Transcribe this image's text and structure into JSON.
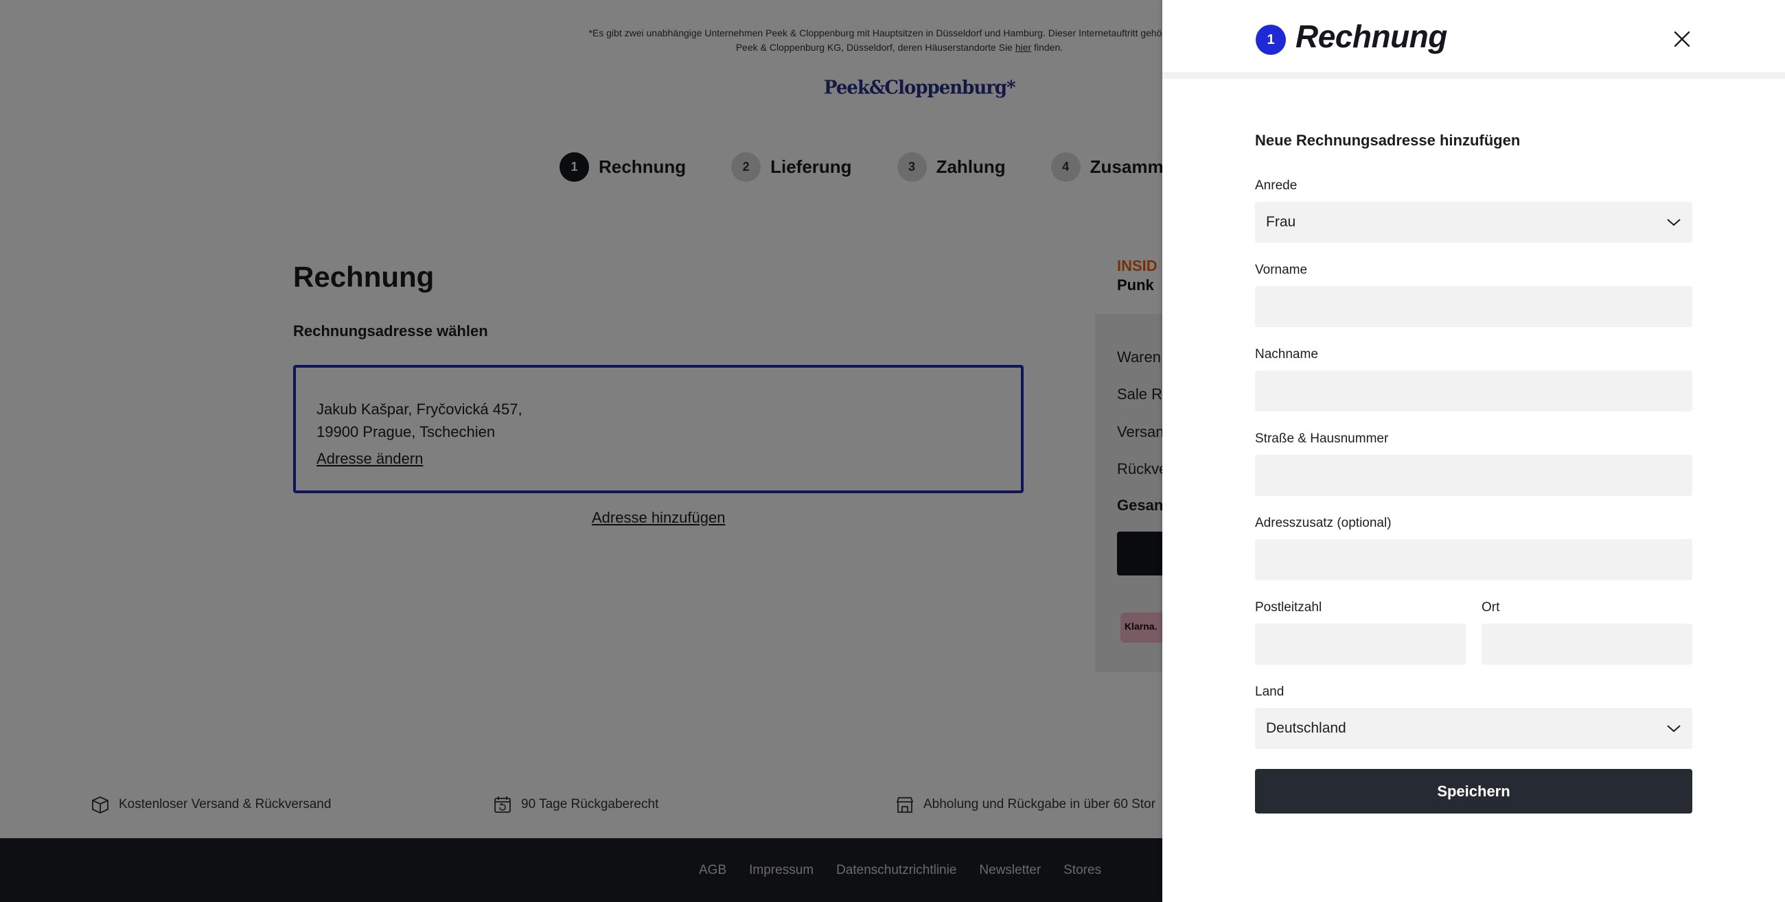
{
  "notice": {
    "line1": "*Es gibt zwei unabhängige Unternehmen Peek & Cloppenburg mit Hauptsitzen in Düsseldorf und Hamburg. Dieser Internetauftritt gehört zur Unter",
    "line2_before": "Peek & Cloppenburg KG, Düsseldorf, deren Häuserstandorte Sie ",
    "link": "hier",
    "line2_after": " finden."
  },
  "logo": "Peek&Cloppenburg*",
  "steps": [
    {
      "num": "1",
      "label": "Rechnung"
    },
    {
      "num": "2",
      "label": "Lieferung"
    },
    {
      "num": "3",
      "label": "Zahlung"
    },
    {
      "num": "4",
      "label": "Zusammenf"
    }
  ],
  "main": {
    "title": "Rechnung",
    "subtitle": "Rechnungsadresse wählen",
    "address_line1": "Jakub Kašpar, Fryčovická 457,",
    "address_line2": "19900 Prague, Tschechien",
    "change_link": "Adresse ändern",
    "add_link": "Adresse hinzufügen"
  },
  "summary": {
    "insider_1": "INSID",
    "insider_2": "Punk",
    "rows": [
      "Waren",
      "Sale R",
      "Versan",
      "Rückve"
    ],
    "total": "Gesan",
    "klarna": "Klarna."
  },
  "features": [
    {
      "icon": "package-icon",
      "text": "Kostenloser Versand & Rückversand"
    },
    {
      "icon": "calendar-return-icon",
      "text": "90 Tage Rückgaberecht"
    },
    {
      "icon": "store-icon",
      "text": "Abholung und Rückgabe in über 60 Stor"
    }
  ],
  "footer": {
    "links": [
      "AGB",
      "Impressum",
      "Datenschutzrichtlinie",
      "Newsletter",
      "Stores"
    ]
  },
  "panel": {
    "step_num": "1",
    "title": "Rechnung",
    "form_title": "Neue Rechnungsadresse hinzufügen",
    "anrede_label": "Anrede",
    "anrede_value": "Frau",
    "vorname_label": "Vorname",
    "vorname_value": "",
    "nachname_label": "Nachname",
    "nachname_value": "",
    "strasse_label": "Straße & Hausnummer",
    "strasse_value": "",
    "zusatz_label": "Adresszusatz (optional)",
    "zusatz_value": "",
    "plz_label": "Postleitzahl",
    "plz_value": "",
    "ort_label": "Ort",
    "ort_value": "",
    "land_label": "Land",
    "land_value": "Deutschland",
    "save_label": "Speichern"
  },
  "colors": {
    "accent_blue": "#1f2ad6",
    "card_border": "#1f2ab0",
    "dark_button": "#262a33",
    "insider_orange": "#e8640c",
    "footer_bg": "#1c1f26"
  }
}
